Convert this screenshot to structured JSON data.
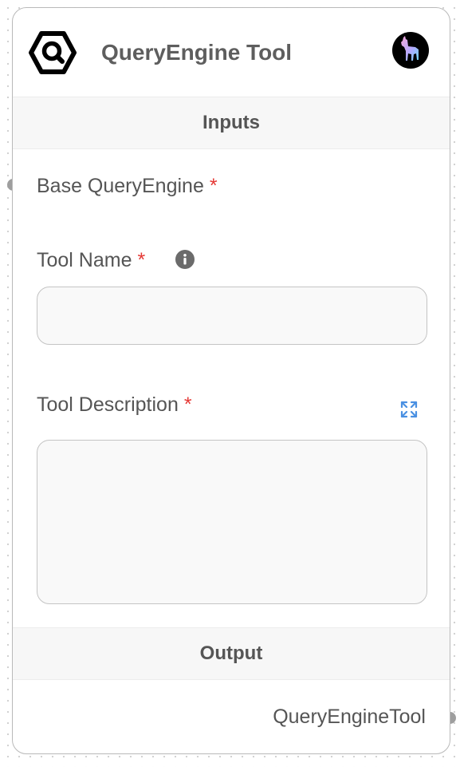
{
  "node": {
    "title": "QueryEngine Tool",
    "node_icon": "query-engine-hexagon-search-icon",
    "provider_badge_icon": "llama-icon"
  },
  "inputs_section": {
    "label": "Inputs",
    "fields": [
      {
        "label": "Base QueryEngine",
        "required_marker": "*"
      },
      {
        "label": "Tool Name",
        "required_marker": "*",
        "info_icon": "info-icon",
        "value": "",
        "placeholder": ""
      },
      {
        "label": "Tool Description",
        "required_marker": "*",
        "action_icon": "expand-icon",
        "value": "",
        "placeholder": ""
      }
    ]
  },
  "output_section": {
    "label": "Output",
    "output_label": "QueryEngineTool"
  },
  "colors": {
    "required": "#e53935",
    "expand_icon": "#4a90e2",
    "handle": "#9e9e9e",
    "section_bar_bg": "#f7f7f7"
  }
}
